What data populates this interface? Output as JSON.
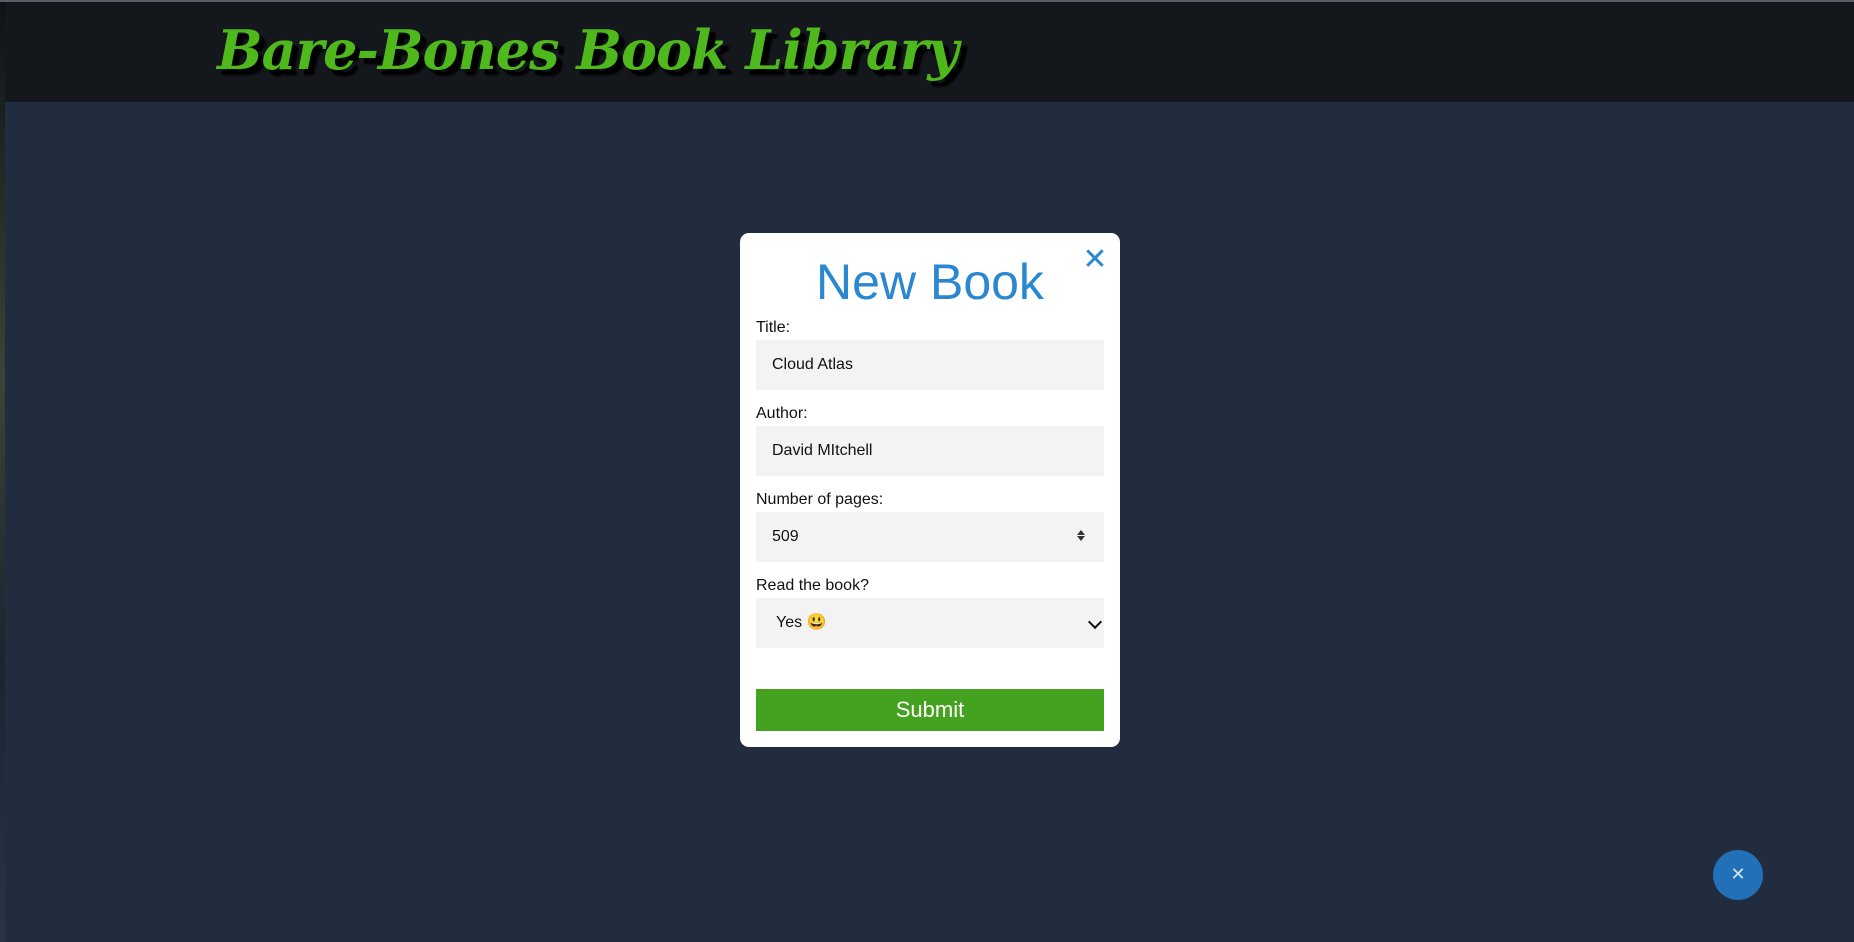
{
  "header": {
    "site_title": "Bare-Bones Book Library",
    "title_color": "#4fb81c"
  },
  "modal": {
    "title": "New Book",
    "close_icon": "close-icon",
    "close_symbol": "✕",
    "fields": {
      "title": {
        "label": "Title:",
        "value": "Cloud Atlas"
      },
      "author": {
        "label": "Author:",
        "value": "David MItchell"
      },
      "pages": {
        "label": "Number of pages:",
        "value": "509"
      },
      "read": {
        "label": "Read the book?",
        "selected": "Yes 😃"
      }
    },
    "submit_label": "Submit",
    "accent_color": "#2a87d0",
    "submit_color": "#45a221"
  },
  "fab": {
    "symbol": "✕",
    "icon": "close-icon",
    "color": "#2170b8"
  }
}
